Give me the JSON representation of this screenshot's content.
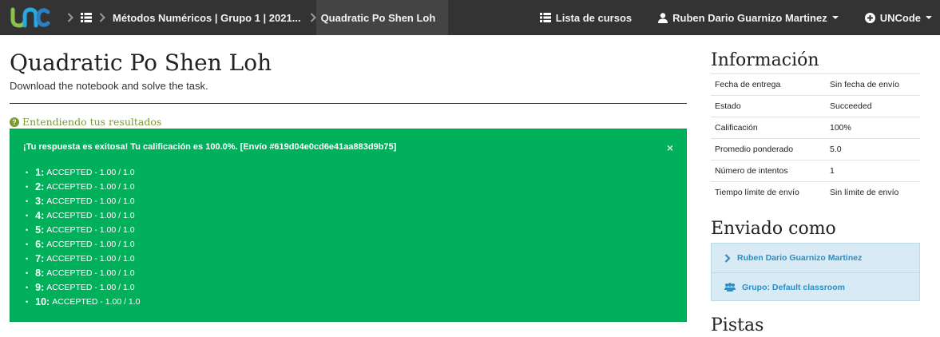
{
  "navbar": {
    "logo_text": "UNC",
    "breadcrumb": {
      "course": "Métodos Numéricos | Grupo 1 | 2021...",
      "task": "Quadratic Po Shen Loh"
    },
    "course_list_label": "Lista de cursos",
    "user_label": "Ruben Dario Guarnizo Martinez",
    "uncode_label": "UNCode"
  },
  "main": {
    "title": "Quadratic Po Shen Loh",
    "subtitle": "Download the notebook and solve the task.",
    "understand_link": "Entendiendo tus resultados",
    "result_message": "¡Tu respuesta es exitosa! Tu calificación es 100.0%. [Envío #619d04e0cd6e41aa883d9b75]",
    "close_label": "×",
    "results": [
      {
        "num": "1:",
        "text": "ACCEPTED - 1.00 / 1.0"
      },
      {
        "num": "2:",
        "text": "ACCEPTED - 1.00 / 1.0"
      },
      {
        "num": "3:",
        "text": "ACCEPTED - 1.00 / 1.0"
      },
      {
        "num": "4:",
        "text": "ACCEPTED - 1.00 / 1.0"
      },
      {
        "num": "5:",
        "text": "ACCEPTED - 1.00 / 1.0"
      },
      {
        "num": "6:",
        "text": "ACCEPTED - 1.00 / 1.0"
      },
      {
        "num": "7:",
        "text": "ACCEPTED - 1.00 / 1.0"
      },
      {
        "num": "8:",
        "text": "ACCEPTED - 1.00 / 1.0"
      },
      {
        "num": "9:",
        "text": "ACCEPTED - 1.00 / 1.0"
      },
      {
        "num": "10:",
        "text": "ACCEPTED - 1.00 / 1.0"
      }
    ]
  },
  "sidebar": {
    "info_heading": "Información",
    "info": [
      {
        "key": "Fecha de entrega",
        "value": "Sin fecha de envío"
      },
      {
        "key": "Estado",
        "value": "Succeeded"
      },
      {
        "key": "Calificación",
        "value": "100%"
      },
      {
        "key": "Promedio ponderado",
        "value": "5.0"
      },
      {
        "key": "Número de intentos",
        "value": "1"
      },
      {
        "key": "Tiempo límite de envío",
        "value": "Sin límite de envío"
      }
    ],
    "sent_heading": "Enviado como",
    "sent_user": "Ruben Dario Guarnizo Martinez",
    "sent_group": "Grupo: Default classroom",
    "hints_heading": "Pistas"
  },
  "colors": {
    "navbar_bg": "#333333",
    "success_bg": "#00b05b",
    "link_green": "#7a9a2e",
    "info_blue": "#2d8cc3",
    "sent_bg": "#d8ebf5"
  },
  "icons": [
    "unc-logo",
    "chevron-right-icon",
    "grid-list-icon",
    "list-icon",
    "user-icon",
    "plus-circle-icon",
    "question-circle-icon",
    "close-icon",
    "users-icon"
  ]
}
